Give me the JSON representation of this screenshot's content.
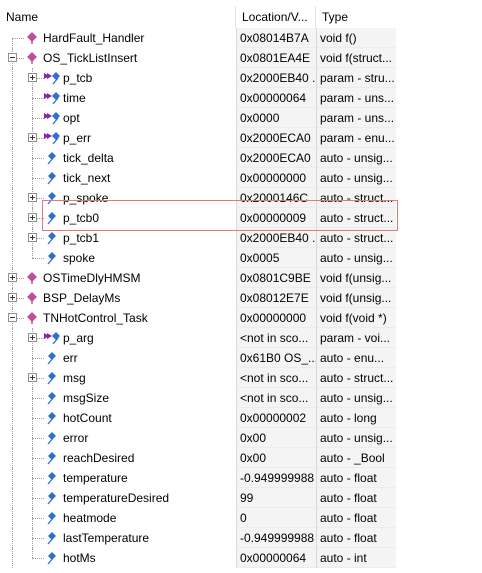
{
  "header": {
    "name": "Name",
    "location": "Location/V...",
    "type": "Type"
  },
  "rows": [
    {
      "name": "HardFault_Handler",
      "loc": "0x08014B7A",
      "type": "void f()",
      "level": 0,
      "expander": "none",
      "icon": "function-icon"
    },
    {
      "name": "OS_TickListInsert",
      "loc": "0x0801EA4E",
      "type": "void f(struct...",
      "level": 0,
      "expander": "minus",
      "icon": "function-icon"
    },
    {
      "name": "p_tcb",
      "loc": "0x2000EB40 ...",
      "type": "param - stru...",
      "level": 1,
      "expander": "plus",
      "icon": "param-icon"
    },
    {
      "name": "time",
      "loc": "0x00000064",
      "type": "param - uns...",
      "level": 1,
      "expander": "none",
      "icon": "param-icon"
    },
    {
      "name": "opt",
      "loc": "0x0000",
      "type": "param - uns...",
      "level": 1,
      "expander": "none",
      "icon": "param-icon"
    },
    {
      "name": "p_err",
      "loc": "0x2000ECA0",
      "type": "param - enu...",
      "level": 1,
      "expander": "plus",
      "icon": "param-icon"
    },
    {
      "name": "tick_delta",
      "loc": "0x2000ECA0",
      "type": "auto - unsig...",
      "level": 1,
      "expander": "none",
      "icon": "variable-icon"
    },
    {
      "name": "tick_next",
      "loc": "0x00000000",
      "type": "auto - unsig...",
      "level": 1,
      "expander": "none",
      "icon": "variable-icon"
    },
    {
      "name": "p_spoke",
      "loc": "0x2000146C",
      "type": "auto - struct...",
      "level": 1,
      "expander": "plus",
      "icon": "variable-icon"
    },
    {
      "name": "p_tcb0",
      "loc": "0x00000009",
      "type": "auto - struct...",
      "level": 1,
      "expander": "plus",
      "icon": "variable-icon"
    },
    {
      "name": "p_tcb1",
      "loc": "0x2000EB40 ...",
      "type": "auto - struct...",
      "level": 1,
      "expander": "plus",
      "icon": "variable-icon"
    },
    {
      "name": "spoke",
      "loc": "0x0005",
      "type": "auto - unsig...",
      "level": 1,
      "expander": "none",
      "icon": "variable-icon"
    },
    {
      "name": "OSTimeDlyHMSM",
      "loc": "0x0801C9BE",
      "type": "void f(unsig...",
      "level": 0,
      "expander": "plus",
      "icon": "function-icon"
    },
    {
      "name": "BSP_DelayMs",
      "loc": "0x08012E7E",
      "type": "void f(unsig...",
      "level": 0,
      "expander": "plus",
      "icon": "function-icon"
    },
    {
      "name": "TNHotControl_Task",
      "loc": "0x00000000",
      "type": "void f(void *)",
      "level": 0,
      "expander": "minus",
      "icon": "function-icon"
    },
    {
      "name": "p_arg",
      "loc": "<not in sco...",
      "type": "param - voi...",
      "level": 1,
      "expander": "plus",
      "icon": "param-icon"
    },
    {
      "name": "err",
      "loc": "0x61B0 OS_...",
      "type": "auto - enu...",
      "level": 1,
      "expander": "none",
      "icon": "variable-icon"
    },
    {
      "name": "msg",
      "loc": "<not in sco...",
      "type": "auto - struct...",
      "level": 1,
      "expander": "plus",
      "icon": "variable-icon"
    },
    {
      "name": "msgSize",
      "loc": "<not in sco...",
      "type": "auto - unsig...",
      "level": 1,
      "expander": "none",
      "icon": "variable-icon"
    },
    {
      "name": "hotCount",
      "loc": "0x00000002",
      "type": "auto - long",
      "level": 1,
      "expander": "none",
      "icon": "variable-icon"
    },
    {
      "name": "error",
      "loc": "0x00",
      "type": "auto - unsig...",
      "level": 1,
      "expander": "none",
      "icon": "variable-icon"
    },
    {
      "name": "reachDesired",
      "loc": "0x00",
      "type": "auto - _Bool",
      "level": 1,
      "expander": "none",
      "icon": "variable-icon"
    },
    {
      "name": "temperature",
      "loc": "-0.949999988",
      "type": "auto - float",
      "level": 1,
      "expander": "none",
      "icon": "variable-icon"
    },
    {
      "name": "temperatureDesired",
      "loc": "99",
      "type": "auto - float",
      "level": 1,
      "expander": "none",
      "icon": "variable-icon"
    },
    {
      "name": "heatmode",
      "loc": "0",
      "type": "auto - float",
      "level": 1,
      "expander": "none",
      "icon": "variable-icon"
    },
    {
      "name": "lastTemperature",
      "loc": "-0.949999988",
      "type": "auto - float",
      "level": 1,
      "expander": "none",
      "icon": "variable-icon"
    },
    {
      "name": "hotMs",
      "loc": "0x00000064",
      "type": "auto - int",
      "level": 1,
      "expander": "none",
      "icon": "variable-icon"
    }
  ],
  "colors": {
    "function_icon": "#c0509c",
    "param_arrow": "#8b1fb5",
    "variable_icon": "#2e6fd0",
    "highlight_border": "#e07a7a"
  }
}
